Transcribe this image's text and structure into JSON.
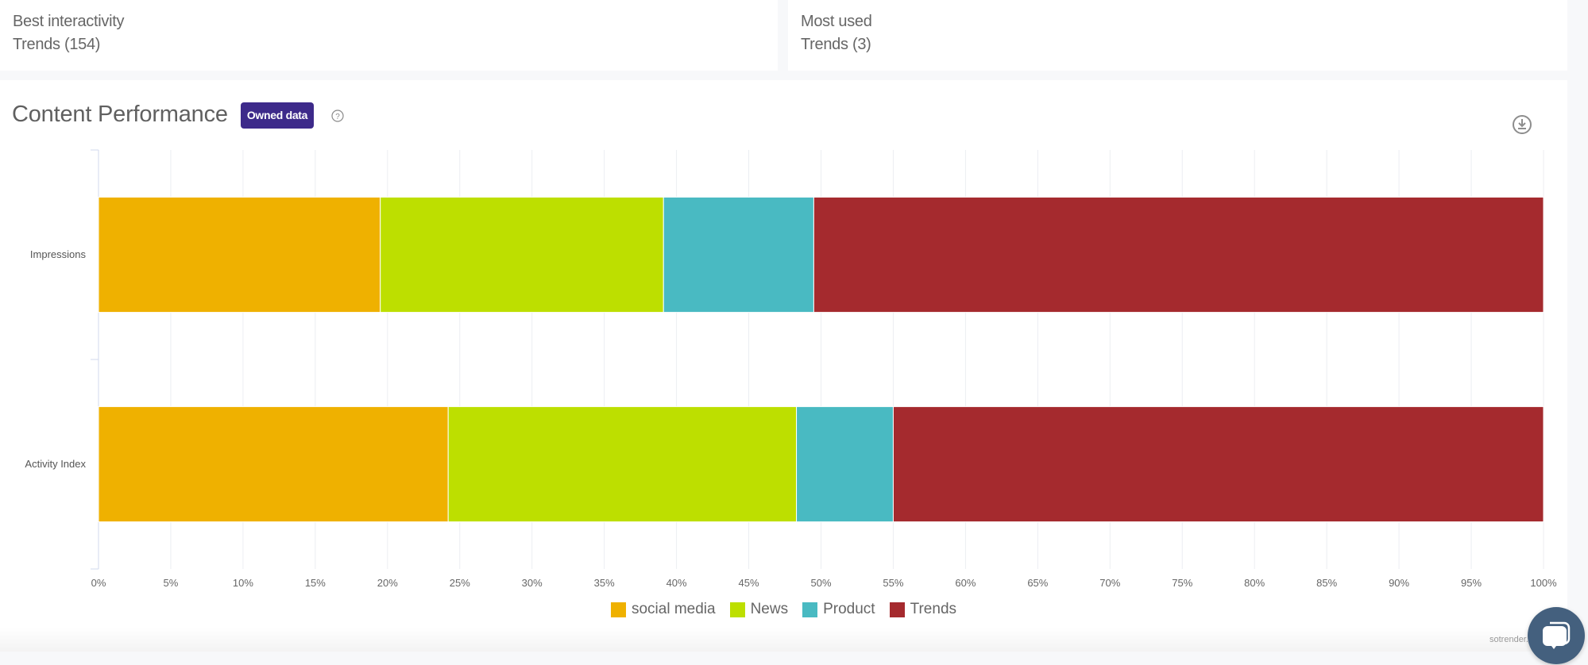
{
  "kpi_cards": [
    {
      "label": "Best interactivity",
      "value": "Trends (154)"
    },
    {
      "label": "Most used",
      "value": "Trends (3)"
    }
  ],
  "main": {
    "title": "Content Performance",
    "badge": "Owned data",
    "help_icon": "question-circle-icon",
    "download_icon": "download-circle-icon"
  },
  "credit": "sotrender.c",
  "chat_icon": "chat-bubbles-icon",
  "colors": {
    "social_media": "#efb100",
    "news": "#bddf00",
    "product": "#49bac2",
    "trends": "#a52a2e",
    "badge": "#3d2a8a",
    "chat": "#44607e"
  },
  "chart_data": {
    "type": "bar",
    "orientation": "horizontal",
    "stacked": "percent",
    "title": "Content Performance",
    "categories": [
      "Impressions",
      "Activity Index"
    ],
    "series": [
      {
        "name": "social media",
        "color": "#efb100",
        "values": [
          19.5,
          24.2
        ]
      },
      {
        "name": "News",
        "color": "#bddf00",
        "values": [
          19.6,
          24.1
        ]
      },
      {
        "name": "Product",
        "color": "#49bac2",
        "values": [
          10.4,
          6.7
        ]
      },
      {
        "name": "Trends",
        "color": "#a52a2e",
        "values": [
          50.5,
          45.0
        ]
      }
    ],
    "xlabel": "",
    "ylabel": "",
    "xlim": [
      0,
      100
    ],
    "xticks": [
      "0%",
      "5%",
      "10%",
      "15%",
      "20%",
      "25%",
      "30%",
      "35%",
      "40%",
      "45%",
      "50%",
      "55%",
      "60%",
      "65%",
      "70%",
      "75%",
      "80%",
      "85%",
      "90%",
      "95%",
      "100%"
    ],
    "grid": true,
    "legend": "bottom-center"
  }
}
